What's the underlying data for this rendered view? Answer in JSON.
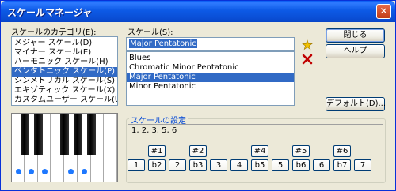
{
  "window": {
    "title": "スケールマネージャ",
    "close_glyph": "✕"
  },
  "categories": {
    "label": "スケールのカテゴリ(E):",
    "items": [
      "メジャー スケール(D)",
      "マイナー スケール(E)",
      "ハーモニック スケール(H)",
      "ペンタトニック スケール(P)",
      "シンメトリカル スケール(S)",
      "エキゾティック スケール(X)",
      "カスタムユーザー スケール(U)"
    ],
    "selected_index": 3
  },
  "scales": {
    "label": "スケール(S):",
    "current": "Major Pentatonic",
    "items": [
      "Blues",
      "Chromatic Minor Pentatonic",
      "Major Pentatonic",
      "Minor Pentatonic"
    ],
    "selected_index": 2
  },
  "buttons": {
    "close": "閉じる",
    "help": "ヘルプ",
    "default": "デフォルト(D)..."
  },
  "icons": {
    "add": "star-add-icon",
    "delete": "delete-x-icon",
    "add_color": "#f0c000",
    "delete_color": "#c00000"
  },
  "settings": {
    "label": "スケールの設定",
    "formula": "1, 2, 3, 5, 6",
    "upper_degrees": [
      {
        "label": "#1",
        "active": false
      },
      {
        "label": "#2",
        "active": false
      },
      {
        "label": "#4",
        "active": false
      },
      {
        "label": "#5",
        "active": false
      },
      {
        "label": "#6",
        "active": false
      }
    ],
    "lower_degrees": [
      {
        "label": "1",
        "active": true
      },
      {
        "label": "b2",
        "active": false
      },
      {
        "label": "2",
        "active": true
      },
      {
        "label": "b3",
        "active": false
      },
      {
        "label": "3",
        "active": true
      },
      {
        "label": "4",
        "active": false
      },
      {
        "label": "b5",
        "active": false
      },
      {
        "label": "5",
        "active": true
      },
      {
        "label": "b6",
        "active": false
      },
      {
        "label": "6",
        "active": true
      },
      {
        "label": "b7",
        "active": false
      },
      {
        "label": "7",
        "active": false
      }
    ]
  },
  "keyboard": {
    "highlighted_white_keys": [
      0,
      1,
      2,
      4,
      5
    ]
  }
}
